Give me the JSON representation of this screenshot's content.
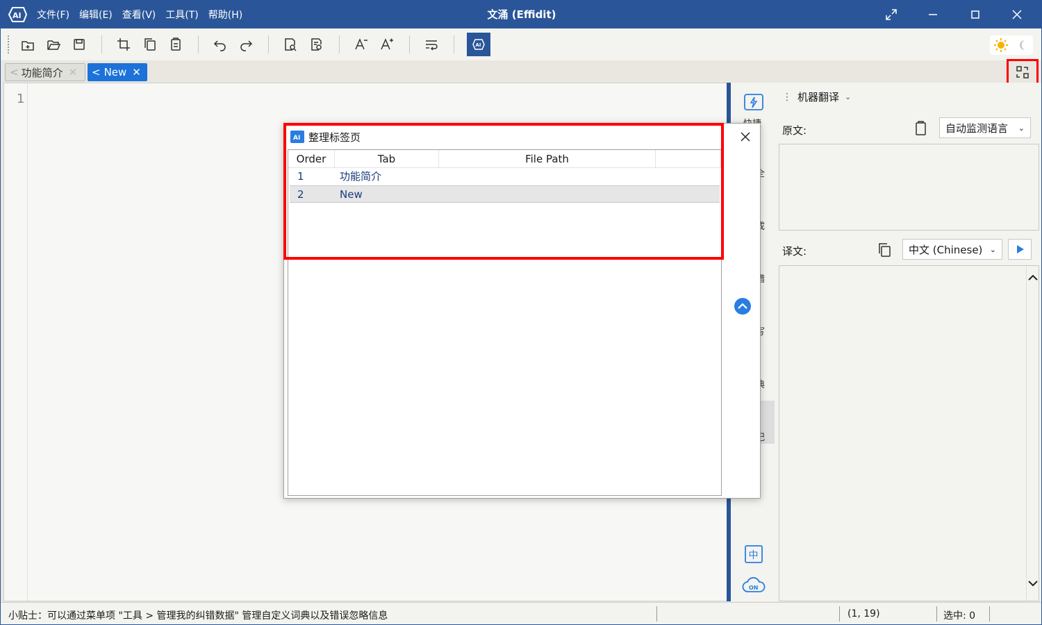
{
  "title_bar": {
    "app_title": "文涌 (Effidit)",
    "menu": [
      "文件(F)",
      "编辑(E)",
      "查看(V)",
      "工具(T)",
      "帮助(H)"
    ]
  },
  "tabs": [
    {
      "label": "功能简介"
    },
    {
      "label": "New"
    }
  ],
  "editor": {
    "line_number": "1"
  },
  "sidebar": {
    "partial_labels": [
      "快捷",
      "全",
      "成",
      "错",
      "写",
      "典",
      "记"
    ],
    "bottom_cloud_label": "ON",
    "bottom_lang_icon": "中"
  },
  "translate_panel": {
    "section_title": "机器翻译",
    "source_label": "原文:",
    "source_lang": "自动监测语言",
    "target_label": "译文:",
    "target_lang": "中文 (Chinese)"
  },
  "dialog": {
    "title": "整理标签页",
    "columns": [
      "Order",
      "Tab",
      "File Path"
    ],
    "rows": [
      {
        "order": "1",
        "tab": "功能简介",
        "path": ""
      },
      {
        "order": "2",
        "tab": "New",
        "path": ""
      }
    ]
  },
  "status_bar": {
    "tip": "小贴士：可以通过菜单项 \"工具 > 管理我的纠错数据\" 管理自定义词典以及错误忽略信息",
    "position": "(1, 19)",
    "selection": "选中: 0"
  },
  "colors": {
    "accent": "#2a5699",
    "tab_active": "#1c72d9",
    "highlight": "#ff0000"
  }
}
